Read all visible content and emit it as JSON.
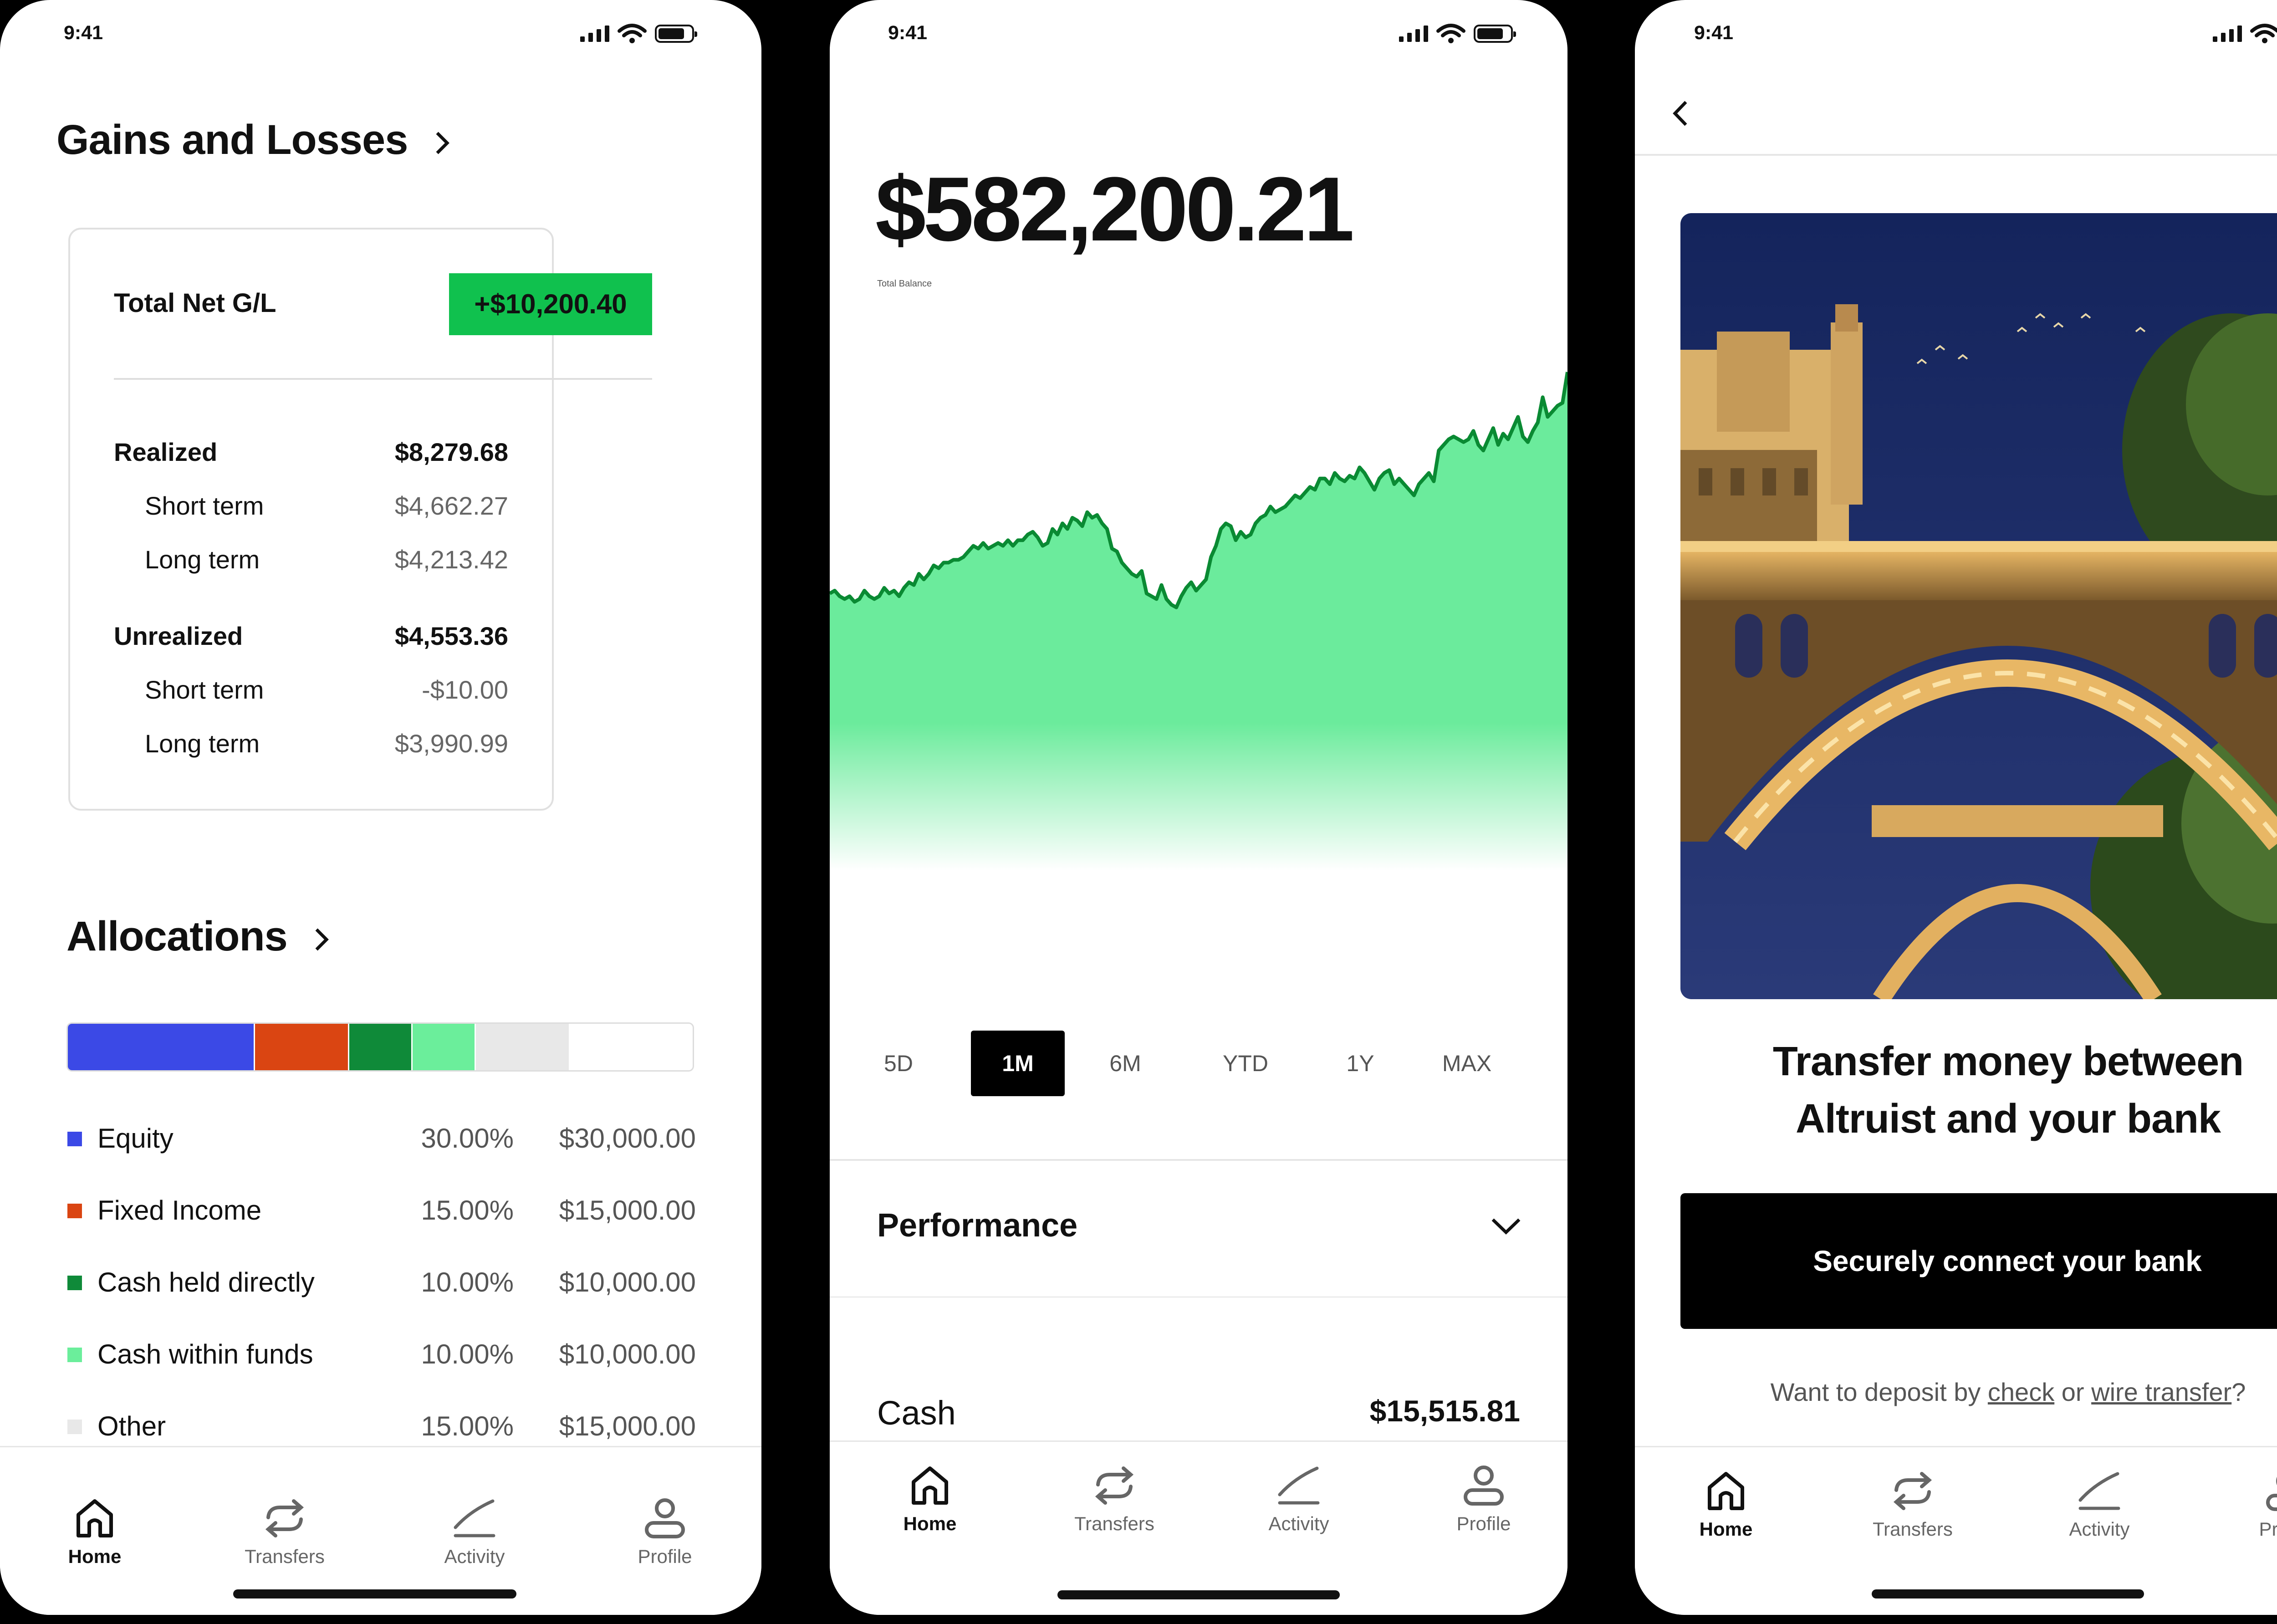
{
  "status": {
    "time": "9:41"
  },
  "nav": {
    "home": "Home",
    "transfers": "Transfers",
    "activity": "Activity",
    "profile": "Profile"
  },
  "gains": {
    "title": "Gains and Losses",
    "total_label": "Total Net G/L",
    "total_value": "+$10,200.40",
    "realized": {
      "label": "Realized",
      "value": "$8,279.68",
      "short_label": "Short term",
      "short_value": "$4,662.27",
      "long_label": "Long term",
      "long_value": "$4,213.42"
    },
    "unrealized": {
      "label": "Unrealized",
      "value": "$4,553.36",
      "short_label": "Short term",
      "short_value": "-$10.00",
      "long_label": "Long term",
      "long_value": "$3,990.99"
    }
  },
  "allocations": {
    "title": "Allocations",
    "items": [
      {
        "name": "Equity",
        "percent": "30.00%",
        "amount": "$30,000.00",
        "color": "#3b49e6",
        "share": 0.3
      },
      {
        "name": "Fixed Income",
        "percent": "15.00%",
        "amount": "$15,000.00",
        "color": "#da4512",
        "share": 0.15
      },
      {
        "name": "Cash held directly",
        "percent": "10.00%",
        "amount": "$10,000.00",
        "color": "#0f8a39",
        "share": 0.1
      },
      {
        "name": "Cash within funds",
        "percent": "10.00%",
        "amount": "$10,000.00",
        "color": "#6bee9b",
        "share": 0.1
      },
      {
        "name": "Other",
        "percent": "15.00%",
        "amount": "$15,000.00",
        "color": "#e8e8e8",
        "share": 0.15
      }
    ]
  },
  "balance": {
    "amount": "$582,200.21",
    "label": "Total Balance",
    "ranges": [
      "5D",
      "1M",
      "6M",
      "YTD",
      "1Y",
      "MAX"
    ],
    "selected_range": "1M",
    "performance_label": "Performance",
    "cash_label": "Cash",
    "cash_value": "$15,515.81"
  },
  "chart_data": {
    "type": "area",
    "title": "",
    "xlabel": "",
    "ylabel": "",
    "x": [
      1,
      2,
      3,
      4,
      5,
      6,
      7,
      8,
      9,
      10,
      11,
      12,
      13,
      14,
      15,
      16,
      17,
      18,
      19,
      20,
      21,
      22,
      23,
      24,
      25,
      26,
      27,
      28,
      29,
      30,
      31,
      32,
      33,
      34,
      35,
      36,
      37,
      38,
      39,
      40,
      41,
      42,
      43,
      44,
      45,
      46,
      47,
      48,
      49,
      50,
      51,
      52,
      53,
      54,
      55,
      56,
      57,
      58,
      59,
      60,
      61,
      62,
      63,
      64,
      65,
      66,
      67,
      68,
      69,
      70,
      71,
      72,
      73,
      74,
      75,
      76,
      77,
      78,
      79,
      80,
      81,
      82,
      83,
      84,
      85,
      86,
      87,
      88,
      89,
      90,
      91,
      92,
      93,
      94,
      95,
      96,
      97,
      98,
      99,
      100,
      101,
      102,
      103,
      104,
      105,
      106,
      107,
      108,
      109,
      110,
      111,
      112,
      113,
      114,
      115,
      116,
      117,
      118,
      119,
      120,
      121,
      122,
      123,
      124,
      125,
      126,
      127,
      128,
      129,
      130,
      131,
      132,
      133,
      134,
      135,
      136,
      137,
      138,
      139,
      140,
      141,
      142,
      143,
      144,
      145,
      146,
      147,
      148,
      149,
      150
    ],
    "series": [
      {
        "values": [
          45,
          46,
          44,
          43,
          44,
          42,
          43,
          46,
          44,
          43,
          44,
          47,
          45,
          46,
          44,
          47,
          49,
          48,
          52,
          50,
          52,
          55,
          54,
          56,
          56,
          57,
          57,
          58,
          60,
          62,
          61,
          63,
          61,
          62,
          63,
          62,
          64,
          62,
          64,
          64,
          66,
          67,
          65,
          62,
          63,
          68,
          66,
          70,
          68,
          72,
          71,
          69,
          74,
          72,
          73,
          70,
          68,
          61,
          60,
          56,
          54,
          52,
          51,
          53,
          45,
          44,
          43,
          48,
          43,
          41,
          40,
          44,
          47,
          49,
          46,
          48,
          50,
          58,
          62,
          68,
          70,
          69,
          64,
          67,
          65,
          66,
          70,
          72,
          73,
          76,
          74,
          75,
          76,
          78,
          80,
          79,
          81,
          83,
          82,
          86,
          86,
          84,
          88,
          86,
          85,
          87,
          86,
          90,
          88,
          85,
          82,
          86,
          88,
          89,
          84,
          86,
          84,
          82,
          80,
          84,
          86,
          88,
          85,
          96,
          98,
          100,
          101,
          100,
          99,
          100,
          103,
          98,
          96,
          100,
          104,
          98,
          102,
          100,
          104,
          108,
          101,
          99,
          103,
          106,
          115,
          108,
          110,
          112,
          113,
          124
        ]
      }
    ],
    "ylim": [
      0,
      130
    ]
  },
  "transfer": {
    "heading_line1": "Transfer money between",
    "heading_line2": "Altruist and your bank",
    "cta": "Securely connect your bank",
    "deposit_prefix": "Want to deposit by ",
    "check_link": "check",
    "deposit_or": " or ",
    "wire_link": "wire transfer",
    "deposit_suffix": "?"
  }
}
